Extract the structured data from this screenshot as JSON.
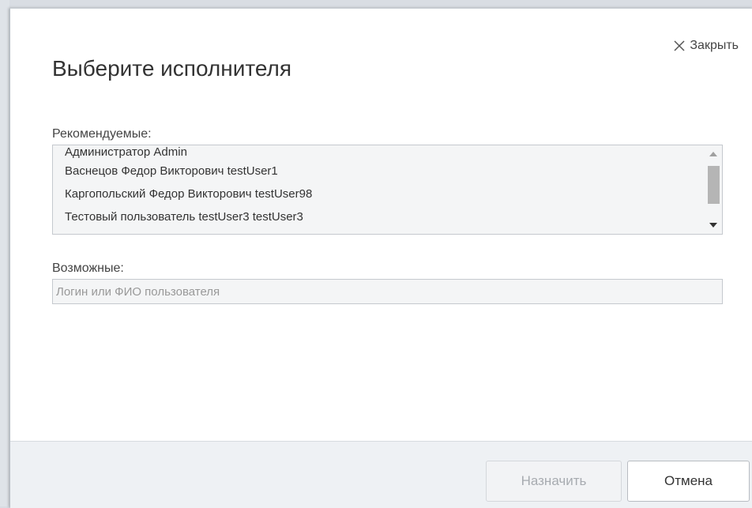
{
  "dialog": {
    "title": "Выберите исполнителя",
    "close_label": "Закрыть"
  },
  "recommended": {
    "label": "Рекомендуемые:",
    "items": [
      "Администратор Admin",
      "Васнецов Федор Викторович testUser1",
      "Каргопольский Федор Викторович testUser98",
      "Тестовый пользователь testUser3 testUser3"
    ]
  },
  "possible": {
    "label": "Возможные:",
    "placeholder": "Логин или ФИО пользователя",
    "value": ""
  },
  "footer": {
    "assign_label": "Назначить",
    "cancel_label": "Отмена"
  },
  "icons": {
    "close": "close-icon",
    "scroll_up": "scroll-up-arrow-icon",
    "scroll_down": "scroll-down-arrow-icon"
  }
}
